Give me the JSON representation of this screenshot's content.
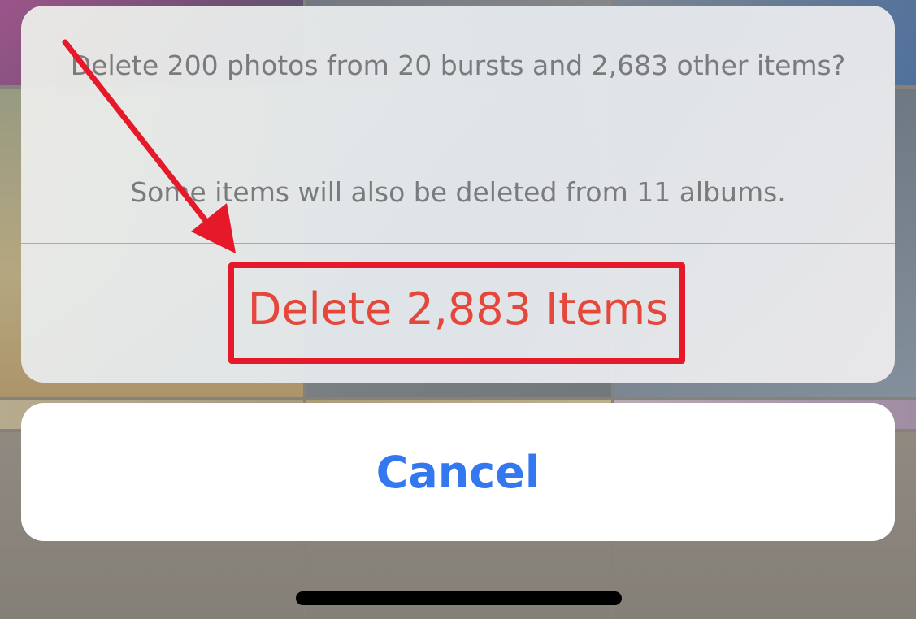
{
  "alert": {
    "message": "Delete 200 photos from 20 bursts and 2,683 other items?",
    "note": "Some items will also be deleted from 11 albums.",
    "delete_label": "Delete 2,883 Items"
  },
  "sheet": {
    "cancel_label": "Cancel"
  },
  "colors": {
    "destructive": "#e5473b",
    "action": "#3478f0",
    "annotation": "#e5192a"
  }
}
